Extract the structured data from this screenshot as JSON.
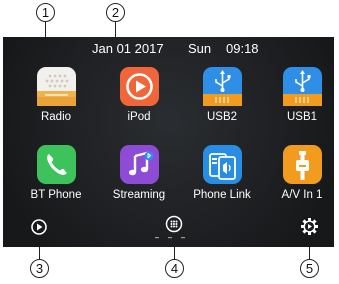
{
  "callouts": [
    "1",
    "2",
    "3",
    "4",
    "5"
  ],
  "status": {
    "date": "Jan 01  2017",
    "day": "Sun",
    "time": "09:18"
  },
  "apps": [
    {
      "label": "Radio",
      "icon": "radio-icon",
      "color": "#f1f0ec"
    },
    {
      "label": "iPod",
      "icon": "ipod-icon",
      "color": "#f0653a"
    },
    {
      "label": "USB2",
      "icon": "usb-icon",
      "color": "#2f8fe6"
    },
    {
      "label": "USB1",
      "icon": "usb-icon",
      "color": "#2f8fe6"
    },
    {
      "label": "BT Phone",
      "icon": "phone-icon",
      "color": "#3dc25c"
    },
    {
      "label": "Streaming",
      "icon": "music-note-icon",
      "color": "#8d4bd6"
    },
    {
      "label": "Phone Link",
      "icon": "phone-link-icon",
      "color": "#2a8de4"
    },
    {
      "label": "A/V In 1",
      "icon": "av-input-icon",
      "color": "#f19b1f"
    }
  ],
  "bottom": {
    "left_icon": "play-circle-icon",
    "center_icon": "app-grid-icon",
    "right_icon": "settings-play-icon"
  }
}
